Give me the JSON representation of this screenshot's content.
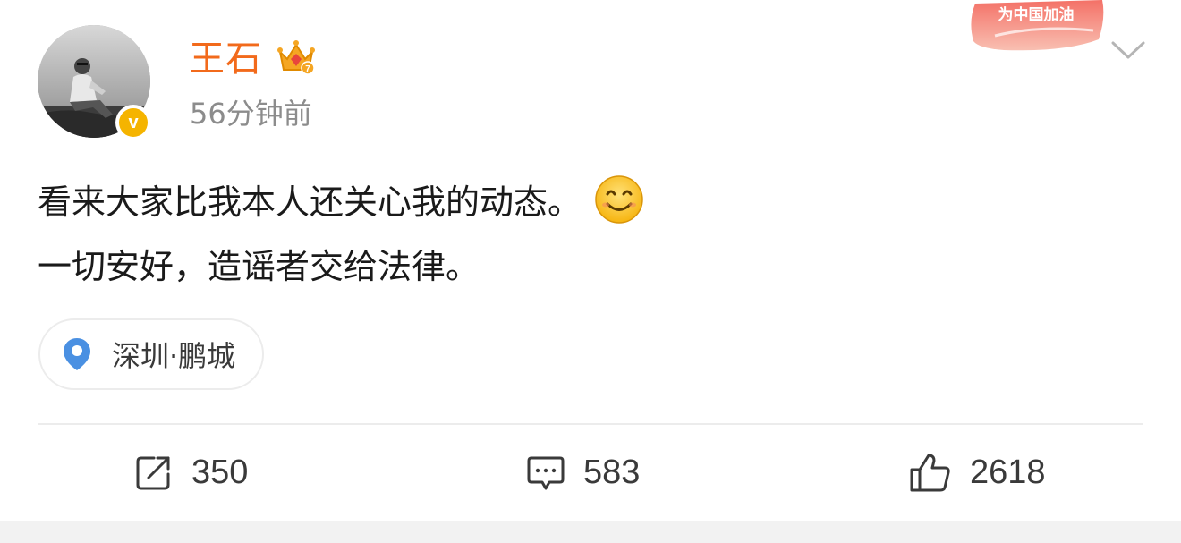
{
  "post": {
    "author": {
      "name": "王石",
      "verified": true
    },
    "timestamp": "56分钟前",
    "topic_badge": "为中国加油",
    "content": {
      "lines": [
        "看来大家比我本人还关心我的动态。",
        "一切安好，造谣者交给法律。"
      ],
      "emoji": "smile-emoji"
    },
    "location": "深圳·鹏城"
  },
  "actions": {
    "repost": {
      "count": "350",
      "icon": "repost-icon"
    },
    "comment": {
      "count": "583",
      "icon": "comment-icon"
    },
    "like": {
      "count": "2618",
      "icon": "like-icon"
    }
  },
  "colors": {
    "username": "#f26a1b",
    "timestamp": "#8c8c8c",
    "verify_badge": "#f5b400",
    "pin": "#4a90e2",
    "topic_badge": "#e8453c"
  }
}
